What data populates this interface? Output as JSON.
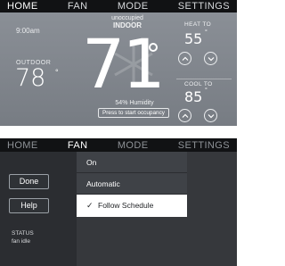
{
  "top_screen": {
    "tabs": [
      {
        "label": "HOME",
        "active": true
      },
      {
        "label": "FAN",
        "active": false
      },
      {
        "label": "MODE",
        "active": false
      },
      {
        "label": "SETTINGS",
        "active": false
      }
    ],
    "time": "9:00am",
    "occupancy_status": "unoccupied",
    "location_label": "INDOOR",
    "outdoor_label": "OUTDOOR",
    "outdoor_temp": "78",
    "outdoor_unit": "°",
    "indoor_temp": "71",
    "humidity": "54% Humidity",
    "occupancy_button": "Press to start occupancy",
    "heat_to_label": "HEAT TO",
    "heat_to_temp": "55",
    "cool_to_label": "COOL TO",
    "cool_to_temp": "85",
    "degree_symbol": "°"
  },
  "bottom_screen": {
    "tabs": [
      {
        "label": "HOME",
        "active": false
      },
      {
        "label": "FAN",
        "active": true
      },
      {
        "label": "MODE",
        "active": false
      },
      {
        "label": "SETTINGS",
        "active": false
      }
    ],
    "done_label": "Done",
    "help_label": "Help",
    "status_label": "STATUS",
    "status_value": "fan idle",
    "fan_options": [
      {
        "label": "On",
        "selected": false
      },
      {
        "label": "Automatic",
        "selected": false
      },
      {
        "label": "Follow Schedule",
        "selected": true
      }
    ],
    "check_mark": "✓"
  },
  "colors": {
    "tab_bar": "#111214",
    "home_background": "#838890",
    "fan_background": "#36383c",
    "selected_item": "#ffffff"
  }
}
